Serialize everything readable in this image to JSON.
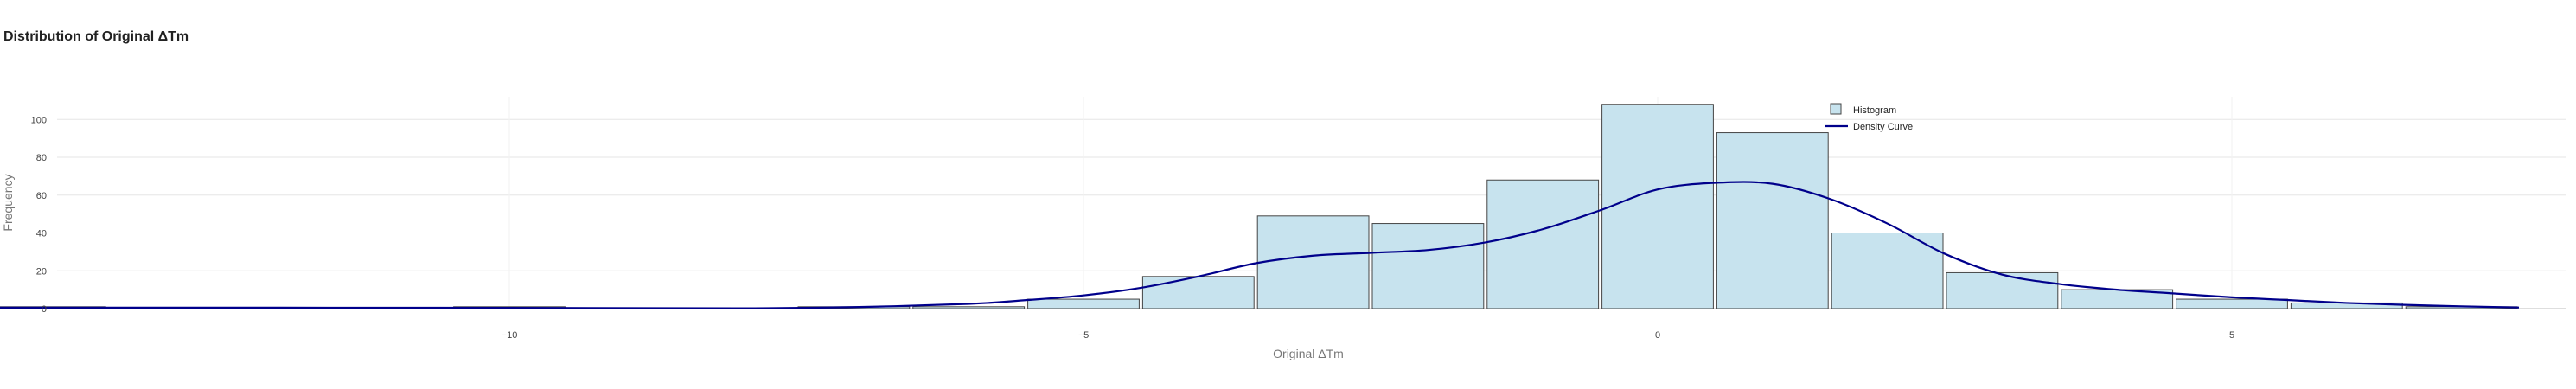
{
  "chart_data": {
    "type": "bar",
    "title": "Distribution of Original ΔTm",
    "xlabel": "Original ΔTm",
    "ylabel": "Frequency",
    "xlim": [
      -14.3,
      7.6
    ],
    "ylim": [
      0,
      112
    ],
    "grid": true,
    "legend_position": "top-right",
    "x_ticks": [
      -10,
      -5,
      0,
      5
    ],
    "x_tick_labels": [
      "−10",
      "−5",
      "0",
      "5"
    ],
    "y_ticks": [
      0,
      20,
      40,
      60,
      80,
      100
    ],
    "bin_width": 1,
    "series": [
      {
        "name": "Histogram",
        "kind": "bar",
        "color": "#c7e3ee",
        "stroke": "#444444",
        "bins": [
          {
            "x": -14,
            "value": 1
          },
          {
            "x": -10,
            "value": 1
          },
          {
            "x": -7,
            "value": 1
          },
          {
            "x": -6,
            "value": 1
          },
          {
            "x": -5,
            "value": 5
          },
          {
            "x": -4,
            "value": 17
          },
          {
            "x": -3,
            "value": 49
          },
          {
            "x": -2,
            "value": 45
          },
          {
            "x": -1,
            "value": 68
          },
          {
            "x": 0,
            "value": 108
          },
          {
            "x": 1,
            "value": 93
          },
          {
            "x": 2,
            "value": 40
          },
          {
            "x": 3,
            "value": 19
          },
          {
            "x": 4,
            "value": 10
          },
          {
            "x": 5,
            "value": 5
          },
          {
            "x": 6,
            "value": 3
          },
          {
            "x": 7,
            "value": 1
          }
        ]
      },
      {
        "name": "Density Curve",
        "kind": "line",
        "color": "#00008b",
        "x": [
          -14.5,
          -12,
          -10,
          -8,
          -7,
          -6,
          -5.5,
          -5,
          -4.5,
          -4,
          -3.5,
          -3,
          -2.5,
          -2,
          -1.5,
          -1,
          -0.5,
          0,
          0.5,
          1,
          1.5,
          2,
          2.5,
          3,
          3.5,
          4,
          4.5,
          5,
          5.5,
          6,
          6.5,
          7,
          7.5
        ],
        "y": [
          0.5,
          0.5,
          0.4,
          0.2,
          0.8,
          2.5,
          4.5,
          7,
          11,
          17,
          24,
          28,
          29.5,
          31,
          35,
          42,
          52,
          63,
          66.5,
          66,
          58,
          45,
          29,
          18,
          13,
          10,
          8,
          6,
          4.5,
          3,
          2,
          1.2,
          0.6
        ]
      }
    ]
  }
}
